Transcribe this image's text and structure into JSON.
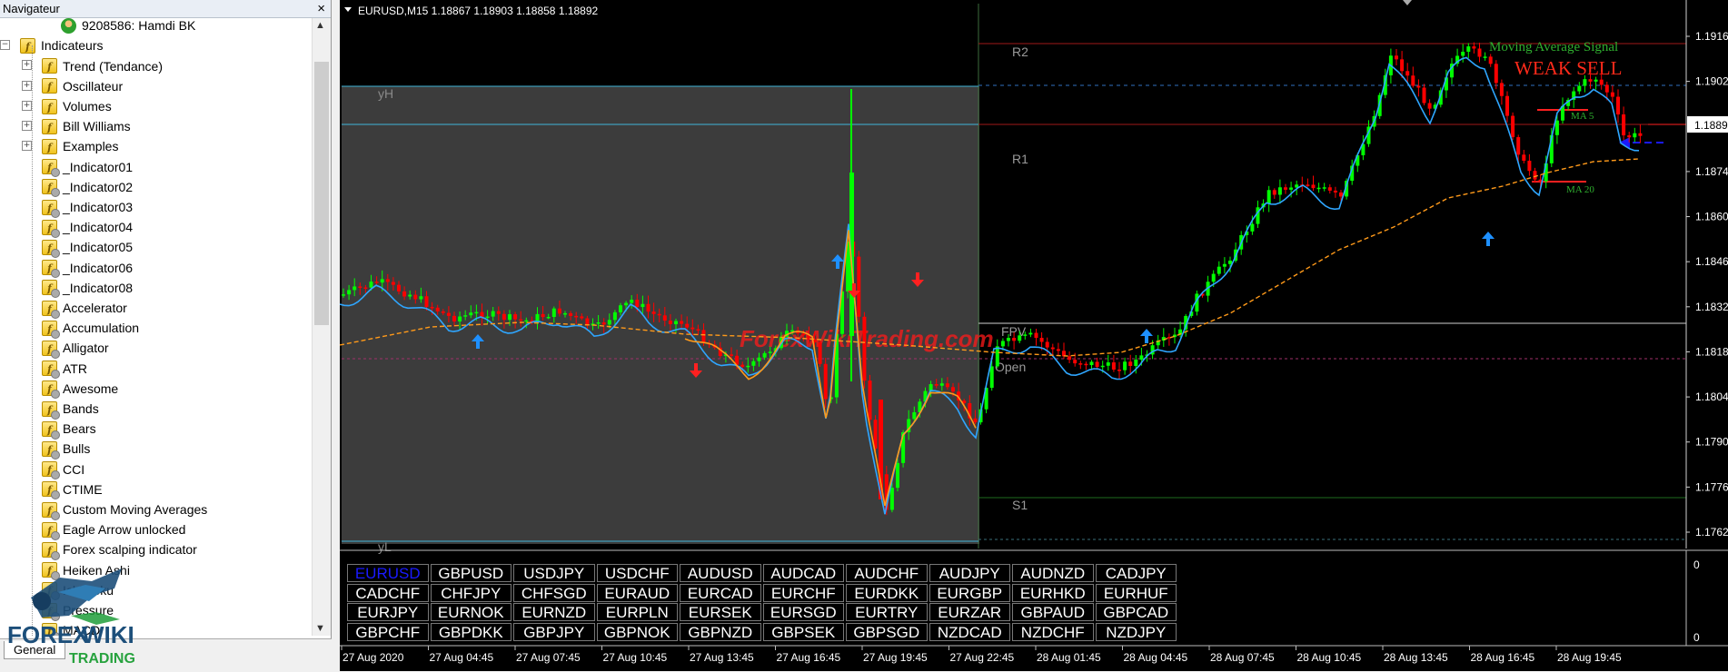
{
  "navigator": {
    "title": "Navigateur",
    "close_label": "×",
    "account": "9208586: Hamdi BK",
    "group": "Indicateurs",
    "folders": [
      "Trend (Tendance)",
      "Oscillateur",
      "Volumes",
      "Bill Williams",
      "Examples"
    ],
    "indicators": [
      "_Indicator01",
      "_Indicator02",
      "_Indicator03",
      "_Indicator04",
      "_Indicator05",
      "_Indicator06",
      "_Indicator08",
      "Accelerator",
      "Accumulation",
      "Alligator",
      "ATR",
      "Awesome",
      "Bands",
      "Bears",
      "Bulls",
      "CCI",
      "CTIME",
      "Custom Moving Averages",
      "Eagle Arrow unlocked",
      "Forex scalping indicator",
      "Heiken Ashi",
      "Ichimoku",
      "Pressure",
      "MACD"
    ],
    "tab_general": "General",
    "logo_top": "FOREX",
    "logo_wiki": "WIKI",
    "logo_bottom": "TRADING"
  },
  "chart": {
    "header": "EURUSD,M15  1.18867 1.18903 1.18858 1.18892",
    "watermark": "ForexWikiTrading.com",
    "signal_title": "Moving Average Signal",
    "signal": "WEAK SELL",
    "ma5_label": "MA 5",
    "ma20_label": "MA 20",
    "levels": {
      "r2": "R2",
      "r1": "R1",
      "s1": "S1",
      "fpv": "FPV",
      "open": "Open",
      "yh": "yH",
      "yl": "yL"
    },
    "current_price": "1.18892",
    "price_ticks": [
      "1.19165",
      "1.19025",
      "1.18745",
      "1.18605",
      "1.18465",
      "1.18325",
      "1.18185",
      "1.18045",
      "1.17905",
      "1.17765",
      "1.17625"
    ],
    "time_ticks": [
      "27 Aug 2020",
      "27 Aug 04:45",
      "27 Aug 07:45",
      "27 Aug 10:45",
      "27 Aug 13:45",
      "27 Aug 16:45",
      "27 Aug 19:45",
      "27 Aug 22:45",
      "28 Aug 01:45",
      "28 Aug 04:45",
      "28 Aug 07:45",
      "28 Aug 10:45",
      "28 Aug 13:45",
      "28 Aug 16:45",
      "28 Aug 19:45"
    ],
    "sub_axis": [
      "0",
      "0"
    ],
    "colors": {
      "bull": "#00ff00",
      "bear": "#ff0000",
      "ma_fast": "#2fa6ff",
      "ma_slow": "#ff9a1a",
      "active_symbol": "#1a1aff",
      "shade": "#3c3c3c"
    }
  },
  "symbols": [
    [
      "EURUSD",
      "GBPUSD",
      "USDJPY",
      "USDCHF",
      "AUDUSD",
      "AUDCAD",
      "AUDCHF",
      "AUDJPY",
      "AUDNZD",
      "CADJPY"
    ],
    [
      "CADCHF",
      "CHFJPY",
      "CHFSGD",
      "EURAUD",
      "EURCAD",
      "EURCHF",
      "EURDKK",
      "EURGBP",
      "EURHKD",
      "EURHUF"
    ],
    [
      "EURJPY",
      "EURNOK",
      "EURNZD",
      "EURPLN",
      "EURSEK",
      "EURSGD",
      "EURTRY",
      "EURZAR",
      "GBPAUD",
      "GBPCAD"
    ],
    [
      "GBPCHF",
      "GBPDKK",
      "GBPJPY",
      "GBPNOK",
      "GBPNZD",
      "GBPSEK",
      "GBPSGD",
      "NZDCAD",
      "NZDCHF",
      "NZDJPY"
    ]
  ],
  "active_symbol": "EURUSD"
}
